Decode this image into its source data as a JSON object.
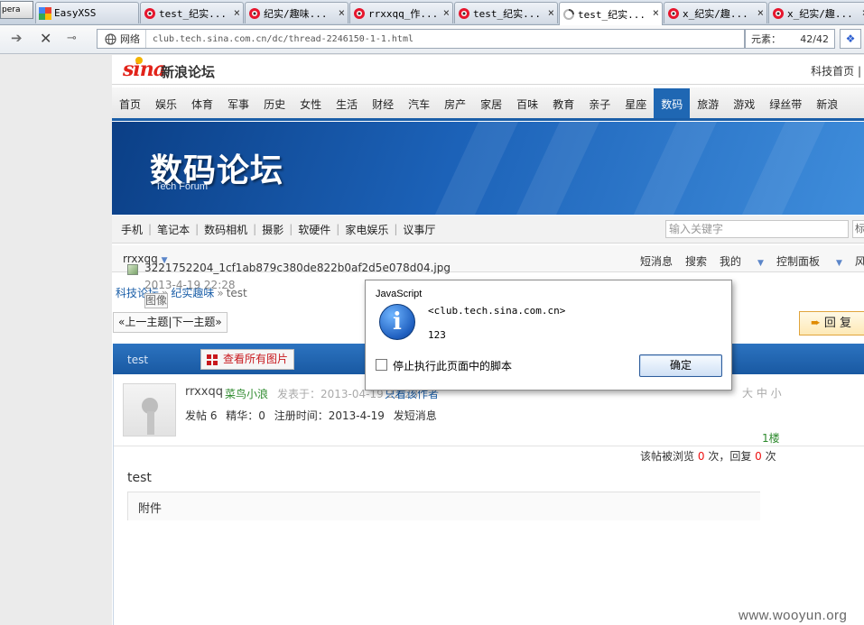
{
  "browser": {
    "menu_button": "pera",
    "tabs": [
      {
        "label": "EasyXSS",
        "icon": "google-icon",
        "active": false
      },
      {
        "label": "test_纪实...",
        "icon": "weibo-icon",
        "active": false
      },
      {
        "label": "纪实/趣味...",
        "icon": "weibo-icon",
        "active": false
      },
      {
        "label": "rrxxqq_作...",
        "icon": "weibo-icon",
        "active": false
      },
      {
        "label": "test_纪实...",
        "icon": "weibo-icon",
        "active": false
      },
      {
        "label": "test_纪实...",
        "icon": "loading-spinner-icon",
        "active": true
      },
      {
        "label": "x_纪实/趣...",
        "icon": "weibo-icon",
        "active": false
      },
      {
        "label": "x_纪实/趣...",
        "icon": "weibo-icon",
        "active": false
      }
    ],
    "tab_close": "×",
    "site_label": "网络",
    "url": "club.tech.sina.com.cn/dc/thread-2246150-1-1.html",
    "elements_label": "元素：",
    "elements_count": "42/42"
  },
  "site": {
    "logo": "sina",
    "forum_name": "新浪论坛",
    "tech_home": "科技首页 |",
    "nav": [
      "首页",
      "娱乐",
      "体育",
      "军事",
      "历史",
      "女性",
      "生活",
      "财经",
      "汽车",
      "房产",
      "家居",
      "百味",
      "教育",
      "亲子",
      "星座",
      "数码",
      "旅游",
      "游戏",
      "绿丝带",
      "新浪"
    ],
    "nav_active_index": 15,
    "banner_title": "数码论坛",
    "banner_subtitle": "Tech Forum",
    "subnav": [
      "手机",
      "笔记本",
      "数码相机",
      "摄影",
      "软硬件",
      "家电娱乐",
      "议事厅"
    ],
    "search_placeholder": "输入关键字",
    "search_button": "标",
    "username": "rrxxqq",
    "user_links": [
      "短消息",
      "搜索",
      "我的",
      "控制面板",
      "风格"
    ]
  },
  "thread": {
    "breadcrumb": [
      "科技论坛",
      "纪实趣味",
      "test"
    ],
    "prev_next": "«上一主题|下一主题»",
    "reply_button": "回 复",
    "title": "test",
    "all_pics": "查看所有图片",
    "post": {
      "author": "rrxxqq",
      "rank": "菜鸟小浪",
      "posted": "发表于：2013-04-19 22:28",
      "only_author": "只看该作者",
      "font_size": "大 中 小",
      "posts_count": "发帖 6",
      "essence": "精华：0",
      "register": "注册时间：2013-4-19",
      "send_msg": "发短消息",
      "floor": "1楼",
      "views_prefix": "该帖被浏览",
      "views": "0",
      "views_mid": "次，回复",
      "replies": "0",
      "views_suffix": "次",
      "body": "test",
      "attachment_title": "附件",
      "attachment_name": "3221752204_1cf1ab879c380de822b0af2d5e078d04.jpg",
      "attachment_date": "2013-4-19 22:28",
      "attachment_image_label": "图像"
    }
  },
  "dialog": {
    "title": "JavaScript",
    "icon": "info-icon",
    "host": "<club.tech.sina.com.cn>",
    "message": "123",
    "checkbox_label": "停止执行此页面中的脚本",
    "ok": "确定"
  },
  "watermark": "www.wooyun.org",
  "colors": {
    "nav_active": "#1f67b3",
    "banner": "#1c62b8",
    "link": "#1a5ea8",
    "rank_green": "#2d8a2d",
    "count_red": "#e11111"
  }
}
